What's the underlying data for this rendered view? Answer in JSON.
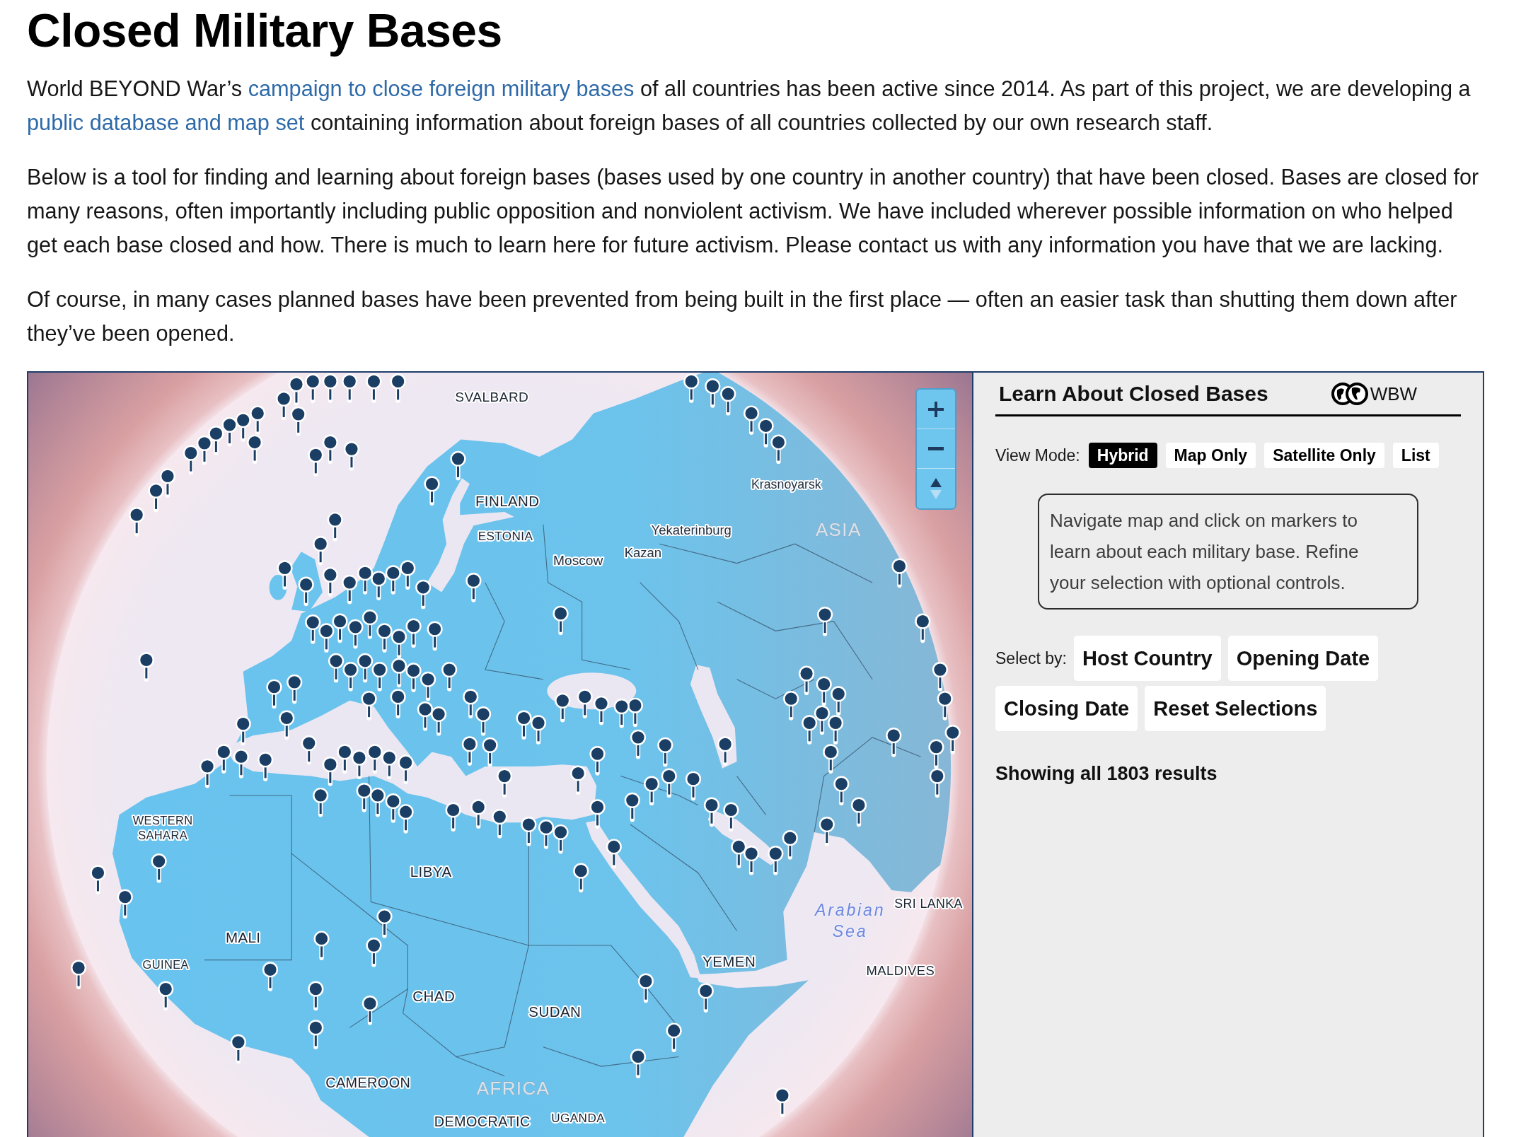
{
  "page": {
    "title": "Closed Military Bases"
  },
  "paragraphs": [
    {
      "segments": [
        {
          "kind": "text",
          "text": "World BEYOND War’s "
        },
        {
          "kind": "link",
          "text": "campaign to close foreign military bases"
        },
        {
          "kind": "text",
          "text": " of all countries has been active since 2014. As part of this project, we are developing a "
        },
        {
          "kind": "link",
          "text": "public database and map set"
        },
        {
          "kind": "text",
          "text": " containing information about foreign bases of all countries collected by our own research staff."
        }
      ]
    },
    {
      "segments": [
        {
          "kind": "text",
          "text": "Below is a tool for finding and learning about foreign bases (bases used by one country in another country) that have been closed. Bases are closed for many reasons, often importantly including public opposition and nonviolent activism. We have included wherever possible information on who helped get each base closed and how. There is much to learn here for future activism. Please contact us with any information you have that we are lacking."
        }
      ]
    },
    {
      "segments": [
        {
          "kind": "text",
          "text": "Of course, in many cases planned bases have been prevented from being built in the first place — often an easier task than shutting them down after they’ve been opened."
        }
      ]
    }
  ],
  "map": {
    "labels": [
      {
        "lines": [
          "SVALBARD"
        ],
        "kind": "region"
      },
      {
        "lines": [
          "FINLAND"
        ],
        "kind": "country"
      },
      {
        "lines": [
          "ESTONIA"
        ],
        "kind": "country"
      },
      {
        "lines": [
          "Moscow"
        ],
        "kind": "city"
      },
      {
        "lines": [
          "Yekaterinburg"
        ],
        "kind": "city"
      },
      {
        "lines": [
          "Kazan"
        ],
        "kind": "city"
      },
      {
        "lines": [
          "Krasnoyarsk"
        ],
        "kind": "city"
      },
      {
        "lines": [
          "ASIA"
        ],
        "kind": "continent"
      },
      {
        "lines": [
          "WESTERN",
          "SAHARA"
        ],
        "kind": "country"
      },
      {
        "lines": [
          "LIBYA"
        ],
        "kind": "country"
      },
      {
        "lines": [
          "MALI"
        ],
        "kind": "country"
      },
      {
        "lines": [
          "GUINEA"
        ],
        "kind": "country"
      },
      {
        "lines": [
          "CHAD"
        ],
        "kind": "country"
      },
      {
        "lines": [
          "SUDAN"
        ],
        "kind": "country"
      },
      {
        "lines": [
          "YEMEN"
        ],
        "kind": "country"
      },
      {
        "lines": [
          "Arabian",
          "Sea"
        ],
        "kind": "sea"
      },
      {
        "lines": [
          "SRI LANKA"
        ],
        "kind": "country"
      },
      {
        "lines": [
          "MALDIVES"
        ],
        "kind": "country"
      },
      {
        "lines": [
          "CAMEROON"
        ],
        "kind": "country"
      },
      {
        "lines": [
          "AFRICA"
        ],
        "kind": "continent"
      },
      {
        "lines": [
          "DEMOCRATIC"
        ],
        "kind": "country"
      },
      {
        "lines": [
          "UGANDA"
        ],
        "kind": "country"
      }
    ]
  },
  "panel": {
    "title": "Learn About Closed Bases",
    "logo_text": "WBW",
    "view_mode": {
      "label": "View Mode:",
      "options": [
        {
          "label": "Hybrid",
          "selected": true
        },
        {
          "label": "Map Only",
          "selected": false
        },
        {
          "label": "Satellite Only",
          "selected": false
        },
        {
          "label": "List",
          "selected": false
        }
      ]
    },
    "instructions": "Navigate map and click on markers to learn about each military base. Refine your selection with optional controls.",
    "select_by": {
      "label": "Select by:",
      "buttons": [
        "Host Country",
        "Opening Date",
        "Closing Date",
        "Reset Selections"
      ]
    },
    "results": "Showing all 1803 results"
  }
}
